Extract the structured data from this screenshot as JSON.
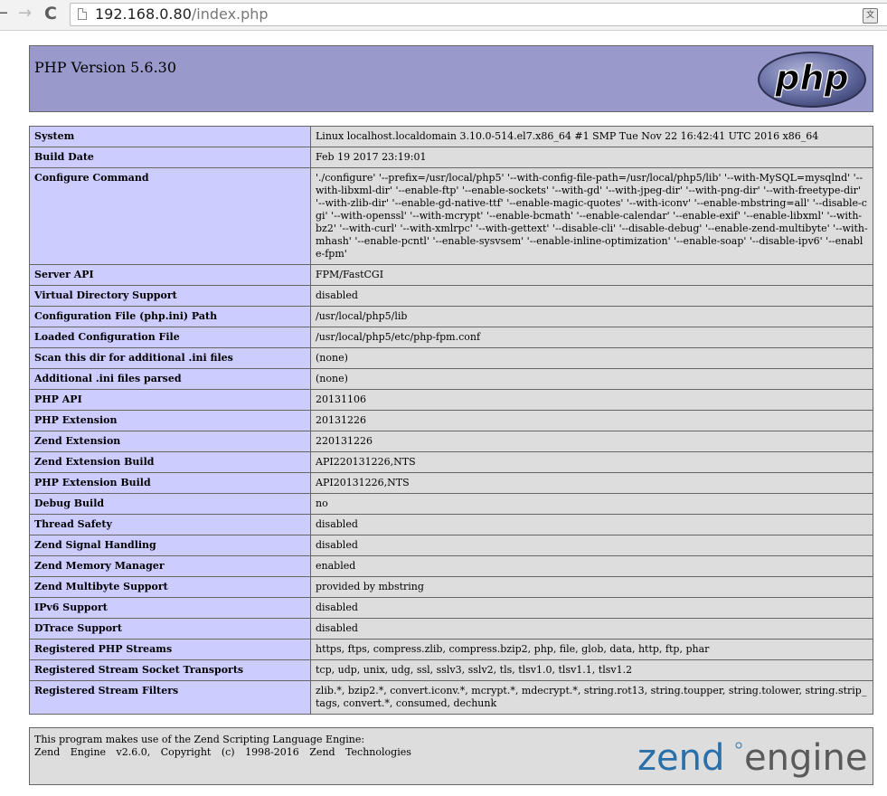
{
  "browser": {
    "url_host": "192.168.0.80",
    "url_path": "/index.php",
    "back_glyph": "←",
    "forward_glyph": "→",
    "reload_glyph": "C",
    "translate_glyph": "文"
  },
  "header": {
    "title": "PHP Version 5.6.30",
    "logo_text": "php"
  },
  "rows": [
    {
      "key": "System",
      "value": "Linux localhost.localdomain 3.10.0-514.el7.x86_64 #1 SMP Tue Nov 22 16:42:41 UTC 2016 x86_64"
    },
    {
      "key": "Build Date",
      "value": "Feb 19 2017 23:19:01"
    },
    {
      "key": "Configure Command",
      "value": "'./configure' '--prefix=/usr/local/php5' '--with-config-file-path=/usr/local/php5/lib' '--with-MySQL=mysqlnd' '--with-libxml-dir' '--enable-ftp' '--enable-sockets' '--with-gd' '--with-jpeg-dir' '--with-png-dir' '--with-freetype-dir' '--with-zlib-dir' '--enable-gd-native-ttf' '--enable-magic-quotes' '--with-iconv' '--enable-mbstring=all' '--disable-cgi' '--with-openssl' '--with-mcrypt' '--enable-bcmath' '--enable-calendar' '--enable-exif' '--enable-libxml' '--with-bz2' '--with-curl' '--with-xmlrpc' '--with-gettext' '--disable-cli' '--disable-debug' '--enable-zend-multibyte' '--with-mhash' '--enable-pcntl' '--enable-sysvsem' '--enable-inline-optimization' '--enable-soap' '--disable-ipv6' '--enable-fpm'"
    },
    {
      "key": "Server API",
      "value": "FPM/FastCGI"
    },
    {
      "key": "Virtual Directory Support",
      "value": "disabled"
    },
    {
      "key": "Configuration File (php.ini) Path",
      "value": "/usr/local/php5/lib"
    },
    {
      "key": "Loaded Configuration File",
      "value": "/usr/local/php5/etc/php-fpm.conf"
    },
    {
      "key": "Scan this dir for additional .ini files",
      "value": "(none)"
    },
    {
      "key": "Additional .ini files parsed",
      "value": "(none)"
    },
    {
      "key": "PHP API",
      "value": "20131106"
    },
    {
      "key": "PHP Extension",
      "value": "20131226"
    },
    {
      "key": "Zend Extension",
      "value": "220131226"
    },
    {
      "key": "Zend Extension Build",
      "value": "API220131226,NTS"
    },
    {
      "key": "PHP Extension Build",
      "value": "API20131226,NTS"
    },
    {
      "key": "Debug Build",
      "value": "no"
    },
    {
      "key": "Thread Safety",
      "value": "disabled"
    },
    {
      "key": "Zend Signal Handling",
      "value": "disabled"
    },
    {
      "key": "Zend Memory Manager",
      "value": "enabled"
    },
    {
      "key": "Zend Multibyte Support",
      "value": "provided by mbstring"
    },
    {
      "key": "IPv6 Support",
      "value": "disabled"
    },
    {
      "key": "DTrace Support",
      "value": "disabled"
    },
    {
      "key": "Registered PHP Streams",
      "value": "https, ftps, compress.zlib, compress.bzip2, php, file, glob, data, http, ftp, phar"
    },
    {
      "key": "Registered Stream Socket Transports",
      "value": "tcp, udp, unix, udg, ssl, sslv3, sslv2, tls, tlsv1.0, tlsv1.1, tlsv1.2"
    },
    {
      "key": "Registered Stream Filters",
      "value": "zlib.*, bzip2.*, convert.iconv.*, mcrypt.*, mdecrypt.*, string.rot13, string.toupper, string.tolower, string.strip_tags, convert.*, consumed, dechunk"
    }
  ],
  "footer": {
    "line1": "This program makes use of the Zend Scripting Language Engine:",
    "line2": "Zend Engine v2.6.0, Copyright (c) 1998-2016 Zend Technologies",
    "logo_word1": "zend",
    "logo_word2": "engine"
  },
  "colors": {
    "header_bg": "#9999cc",
    "key_bg": "#ccccff",
    "value_bg": "#dddddd",
    "zend_blue": "#2a6fa8",
    "zend_gray": "#5a5a5a"
  }
}
